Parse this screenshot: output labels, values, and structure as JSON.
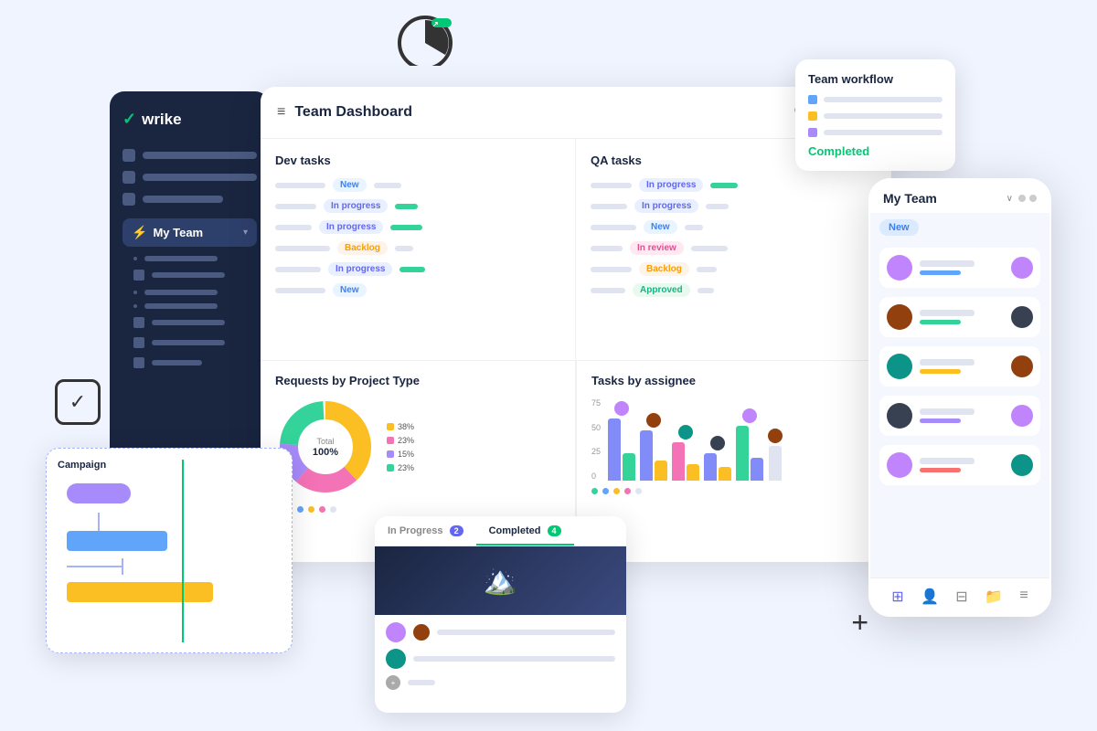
{
  "app": {
    "name": "Wrike",
    "logo_check": "✓",
    "logo_text": "wrike"
  },
  "sidebar": {
    "team_label": "My Team",
    "team_chevron": "▾",
    "lightning": "⚡"
  },
  "dashboard": {
    "menu_icon": "≡",
    "title": "Team Dashboard",
    "add_icon": "+",
    "dev_tasks": {
      "title": "Dev tasks",
      "tasks": [
        {
          "status": "New",
          "badge_class": "badge-new"
        },
        {
          "status": "In progress",
          "badge_class": "badge-inprogress"
        },
        {
          "status": "In progress",
          "badge_class": "badge-inprogress"
        },
        {
          "status": "Backlog",
          "badge_class": "badge-backlog"
        },
        {
          "status": "In progress",
          "badge_class": "badge-inprogress"
        },
        {
          "status": "New",
          "badge_class": "badge-new"
        }
      ]
    },
    "qa_tasks": {
      "title": "QA tasks",
      "tasks": [
        {
          "status": "In progress",
          "badge_class": "badge-inprogress"
        },
        {
          "status": "In progress",
          "badge_class": "badge-inprogress"
        },
        {
          "status": "New",
          "badge_class": "badge-new"
        },
        {
          "status": "In review",
          "badge_class": "badge-inreview"
        },
        {
          "status": "Backlog",
          "badge_class": "badge-backlog"
        },
        {
          "status": "Approved",
          "badge_class": "badge-approved"
        }
      ]
    },
    "requests": {
      "title": "Requests by Project Type",
      "segments": [
        {
          "label": "38%",
          "color": "#fbbf24"
        },
        {
          "label": "23%",
          "color": "#f472b6"
        },
        {
          "label": "15%",
          "color": "#a78bfa"
        },
        {
          "label": "23%",
          "color": "#34d399"
        }
      ]
    },
    "assignee": {
      "title": "Tasks by assignee",
      "y_labels": [
        "75",
        "50",
        "25",
        "0"
      ]
    }
  },
  "workflow_card": {
    "title": "Team workflow",
    "rows": [
      {
        "color": "#60a5fa"
      },
      {
        "color": "#fbbf24"
      },
      {
        "color": "#a78bfa"
      }
    ],
    "completed_label": "Completed"
  },
  "mobile_card": {
    "title": "My Team",
    "chevron": "∨",
    "new_label": "New",
    "team_members": [
      {
        "avatar_class": ""
      },
      {
        "avatar_class": "brown"
      },
      {
        "avatar_class": "teal"
      },
      {
        "avatar_class": "dark"
      },
      {
        "avatar_class": ""
      },
      {
        "avatar_class": "brown"
      }
    ],
    "tabs": [
      "⊞",
      "👤",
      "⊟",
      "📁",
      "≡"
    ]
  },
  "campaign_card": {
    "title": "Campaign"
  },
  "tasks_card": {
    "tab_inprogress": "In Progress",
    "tab_inprogress_count": "2",
    "tab_completed": "Completed",
    "tab_completed_count": "4",
    "image_icon": "🏔️"
  },
  "float_icons": {
    "play": "▶",
    "check": "✓",
    "plus": "+"
  }
}
